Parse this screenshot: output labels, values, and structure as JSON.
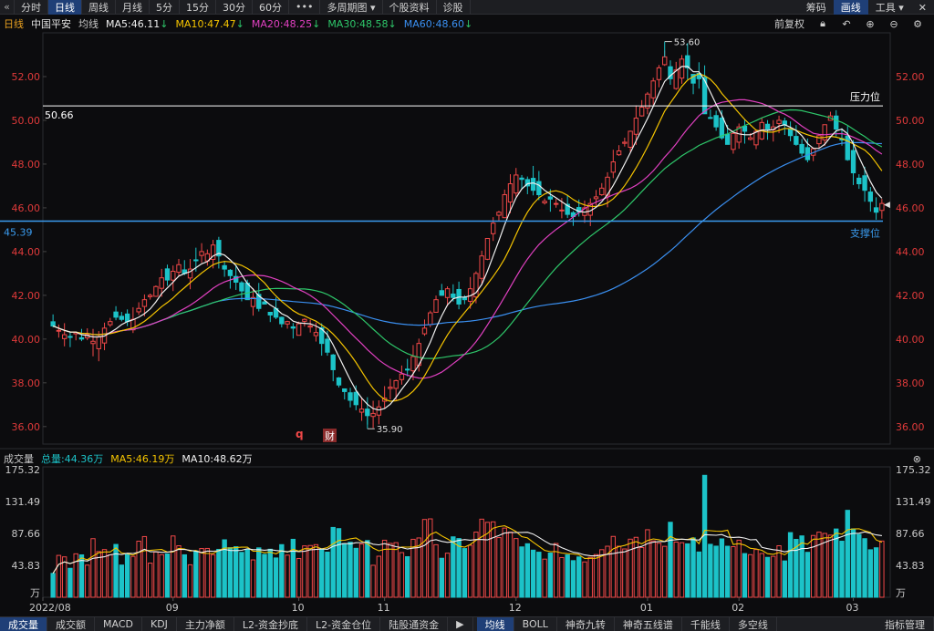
{
  "toolbar": {
    "back_icon": "double-chevron-left-icon",
    "periods": [
      "分时",
      "日线",
      "周线",
      "月线",
      "5分",
      "15分",
      "30分",
      "60分",
      "•••",
      "多周期图 ▾",
      "个股资料",
      "诊股"
    ],
    "active_period": "日线",
    "right": [
      "筹码",
      "画线",
      "工具 ▾"
    ],
    "right_active": "画线",
    "close_icon": "close-icon"
  },
  "info": {
    "period": "日线",
    "stock": "中国平安",
    "ma_label": "均线",
    "ma5": "MA5:46.11",
    "ma10": "MA10:47.47",
    "ma20": "MA20:48.25",
    "ma30": "MA30:48.58",
    "ma60": "MA60:48.60",
    "adjust": "前复权",
    "icons": [
      "lock-icon",
      "undo-icon",
      "zoom-in-icon",
      "zoom-out-icon",
      "settings-icon"
    ]
  },
  "volume_info": {
    "title": "成交量",
    "total": "总量:44.36万",
    "ma5": "MA5:46.19万",
    "ma10": "MA10:48.62万",
    "close_icon": "close-circle-icon"
  },
  "bottom": {
    "tabs": [
      "成交量",
      "成交额",
      "MACD",
      "KDJ",
      "主力净额",
      "L2-资金抄底",
      "L2-资金仓位",
      "陆股通资金",
      "▶"
    ],
    "tabs2": [
      "均线",
      "BOLL",
      "神奇九转",
      "神奇五线谱",
      "千能线",
      "多空线"
    ],
    "right": "指标管理",
    "active": [
      "成交量",
      "均线"
    ]
  },
  "colors": {
    "up": "#f04848",
    "down": "#1cc3c8",
    "ma5": "#f0f0f0",
    "ma10": "#f5c400",
    "ma20": "#e040c0",
    "ma30": "#2ec76a",
    "ma60": "#3a8ff0",
    "price_axis": "#e03a3a",
    "resistance": "#ffffff",
    "support": "#3a9cf0"
  },
  "chart_data": {
    "type": "candlestick",
    "instrument": "中国平安",
    "ylim": [
      35.2,
      54.0
    ],
    "yticks": [
      "52.00",
      "50.00",
      "48.00",
      "46.00",
      "44.00",
      "42.00",
      "40.00",
      "38.00",
      "36.00"
    ],
    "xticks": [
      {
        "label": "2022/08",
        "i": 0
      },
      {
        "label": "09",
        "i": 21
      },
      {
        "label": "10",
        "i": 43
      },
      {
        "label": "11",
        "i": 58
      },
      {
        "label": "12",
        "i": 81
      },
      {
        "label": "01",
        "i": 104
      },
      {
        "label": "02",
        "i": 120
      },
      {
        "label": "03",
        "i": 140
      }
    ],
    "close": [
      40.6,
      40.4,
      40.2,
      40.1,
      40.3,
      40.0,
      40.2,
      39.9,
      40.1,
      40.5,
      40.8,
      41.0,
      40.9,
      40.8,
      40.9,
      41.4,
      41.8,
      42.0,
      42.4,
      42.8,
      42.7,
      43.1,
      43.4,
      43.0,
      43.2,
      43.6,
      44.0,
      43.9,
      44.3,
      43.8,
      43.2,
      42.9,
      42.6,
      42.2,
      41.8,
      41.9,
      41.4,
      41.6,
      41.1,
      41.0,
      40.7,
      40.8,
      40.5,
      40.7,
      40.9,
      40.6,
      40.3,
      39.8,
      39.4,
      38.6,
      37.9,
      37.6,
      37.2,
      37.0,
      36.8,
      36.5,
      36.6,
      36.9,
      37.3,
      37.8,
      38.1,
      38.4,
      38.6,
      39.2,
      39.8,
      40.5,
      41.2,
      41.8,
      42.0,
      42.3,
      41.9,
      41.6,
      41.8,
      42.3,
      43.0,
      43.8,
      44.6,
      45.3,
      45.8,
      46.6,
      47.1,
      47.5,
      47.3,
      47.0,
      46.8,
      46.6,
      46.3,
      46.4,
      46.2,
      45.9,
      45.7,
      45.6,
      45.8,
      46.0,
      46.2,
      46.5,
      46.9,
      47.4,
      48.1,
      48.6,
      49.0,
      49.5,
      50.1,
      50.6,
      51.2,
      51.8,
      52.4,
      52.9,
      51.9,
      52.3,
      52.8,
      52.4,
      51.7,
      51.9,
      50.3,
      50.1,
      49.7,
      49.2,
      48.9,
      49.4,
      49.7,
      49.5,
      49.2,
      49.5,
      49.9,
      49.6,
      49.7,
      50.0,
      49.8,
      49.3,
      48.9,
      48.5,
      48.2,
      48.7,
      49.3,
      49.8,
      50.2,
      49.6,
      49.1,
      48.2,
      47.6,
      47.1,
      46.8,
      46.3,
      45.8,
      46.2
    ],
    "volume_unit": "万",
    "volume_ticks": [
      "175.32",
      "131.49",
      "87.66",
      "43.83",
      "万"
    ],
    "annotations": [
      {
        "text": "53.60",
        "kind": "high"
      },
      {
        "text": "35.90",
        "kind": "low"
      },
      {
        "text": "50.66",
        "kind": "resistance-value"
      },
      {
        "text": "压力位",
        "kind": "resistance-label"
      },
      {
        "text": "45.39",
        "kind": "support-value"
      },
      {
        "text": "支撑位",
        "kind": "support-label"
      },
      {
        "text": "q",
        "kind": "event-marker"
      },
      {
        "text": "财",
        "kind": "event-badge"
      }
    ],
    "levels": {
      "high": 53.6,
      "low": 35.9,
      "resistance": 50.66,
      "support": 45.39
    },
    "legend": "top-left"
  }
}
